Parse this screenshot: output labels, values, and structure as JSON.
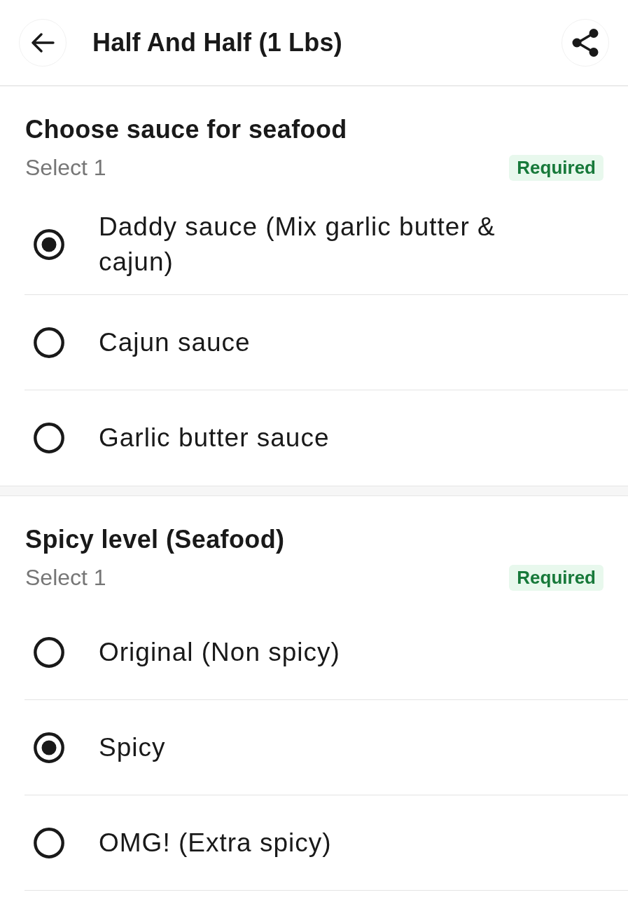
{
  "header": {
    "title": "Half And Half (1 Lbs)"
  },
  "sections": [
    {
      "title": "Choose sauce for seafood",
      "subtitle": "Select 1",
      "badge": "Required",
      "options": [
        {
          "label": "Daddy sauce (Mix garlic butter & cajun)",
          "selected": true
        },
        {
          "label": "Cajun sauce",
          "selected": false
        },
        {
          "label": "Garlic butter sauce",
          "selected": false
        }
      ]
    },
    {
      "title": "Spicy level (Seafood)",
      "subtitle": "Select 1",
      "badge": "Required",
      "options": [
        {
          "label": "Original (Non spicy)",
          "selected": false
        },
        {
          "label": "Spicy",
          "selected": true
        },
        {
          "label": "OMG! (Extra spicy)",
          "selected": false
        }
      ]
    }
  ]
}
